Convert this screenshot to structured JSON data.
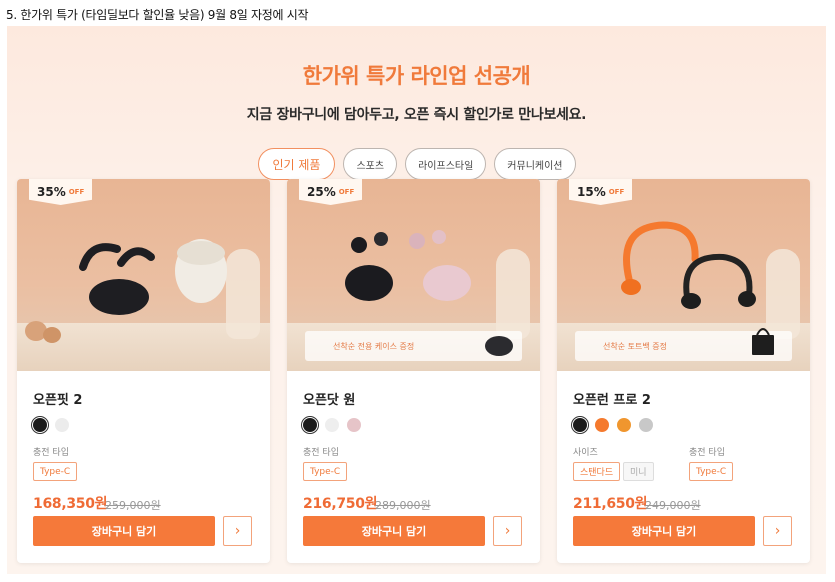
{
  "note": "5. 한가위 특가 (타임딜보다 할인율 낮음) 9월 8일 자정에 시작",
  "banner": {
    "headline": "한가위 특가 라인업 선공개",
    "subline": "지금 장바구니에 담아두고, 오픈 즉시 할인가로 만나보세요."
  },
  "tabs": [
    {
      "label": "인기 제품",
      "active": true
    },
    {
      "label": "스포츠",
      "active": false
    },
    {
      "label": "라이프스타일",
      "active": false
    },
    {
      "label": "커뮤니케이션",
      "active": false
    }
  ],
  "products": [
    {
      "badge": "35%",
      "badge_off": "OFF",
      "name": "오픈핏 2",
      "gift": "",
      "colors": [
        "#1b1b1b",
        "#ececec"
      ],
      "charge_label": "충전 타입",
      "charge_type": "Type-C",
      "size_label": "",
      "sizes": [],
      "price": "168,350원",
      "original_price": "259,000원",
      "cart_label": "장바구니 담기",
      "more_icon": "›"
    },
    {
      "badge": "25%",
      "badge_off": "OFF",
      "name": "오픈닷 원",
      "gift": "선착순 전용 케이스 증정",
      "colors": [
        "#1b1b1b",
        "#eeeeee",
        "#e6c4c8"
      ],
      "charge_label": "충전 타입",
      "charge_type": "Type-C",
      "size_label": "",
      "sizes": [],
      "price": "216,750원",
      "original_price": "289,000원",
      "cart_label": "장바구니 담기",
      "more_icon": "›"
    },
    {
      "badge": "15%",
      "badge_off": "OFF",
      "name": "오픈런 프로 2",
      "gift": "선착순 토트백 증정",
      "colors": [
        "#1b1b1b",
        "#f57a2e",
        "#f0962e",
        "#c8c8c8"
      ],
      "charge_label": "충전 타입",
      "charge_type": "Type-C",
      "size_label": "사이즈",
      "sizes": [
        "스탠다드",
        "미니"
      ],
      "price": "211,650원",
      "original_price": "249,000원",
      "cart_label": "장바구니 담기",
      "more_icon": "›"
    }
  ],
  "colors": {
    "accent": "#f5793a",
    "headline": "#f07a3b",
    "price": "#ef6b35"
  }
}
